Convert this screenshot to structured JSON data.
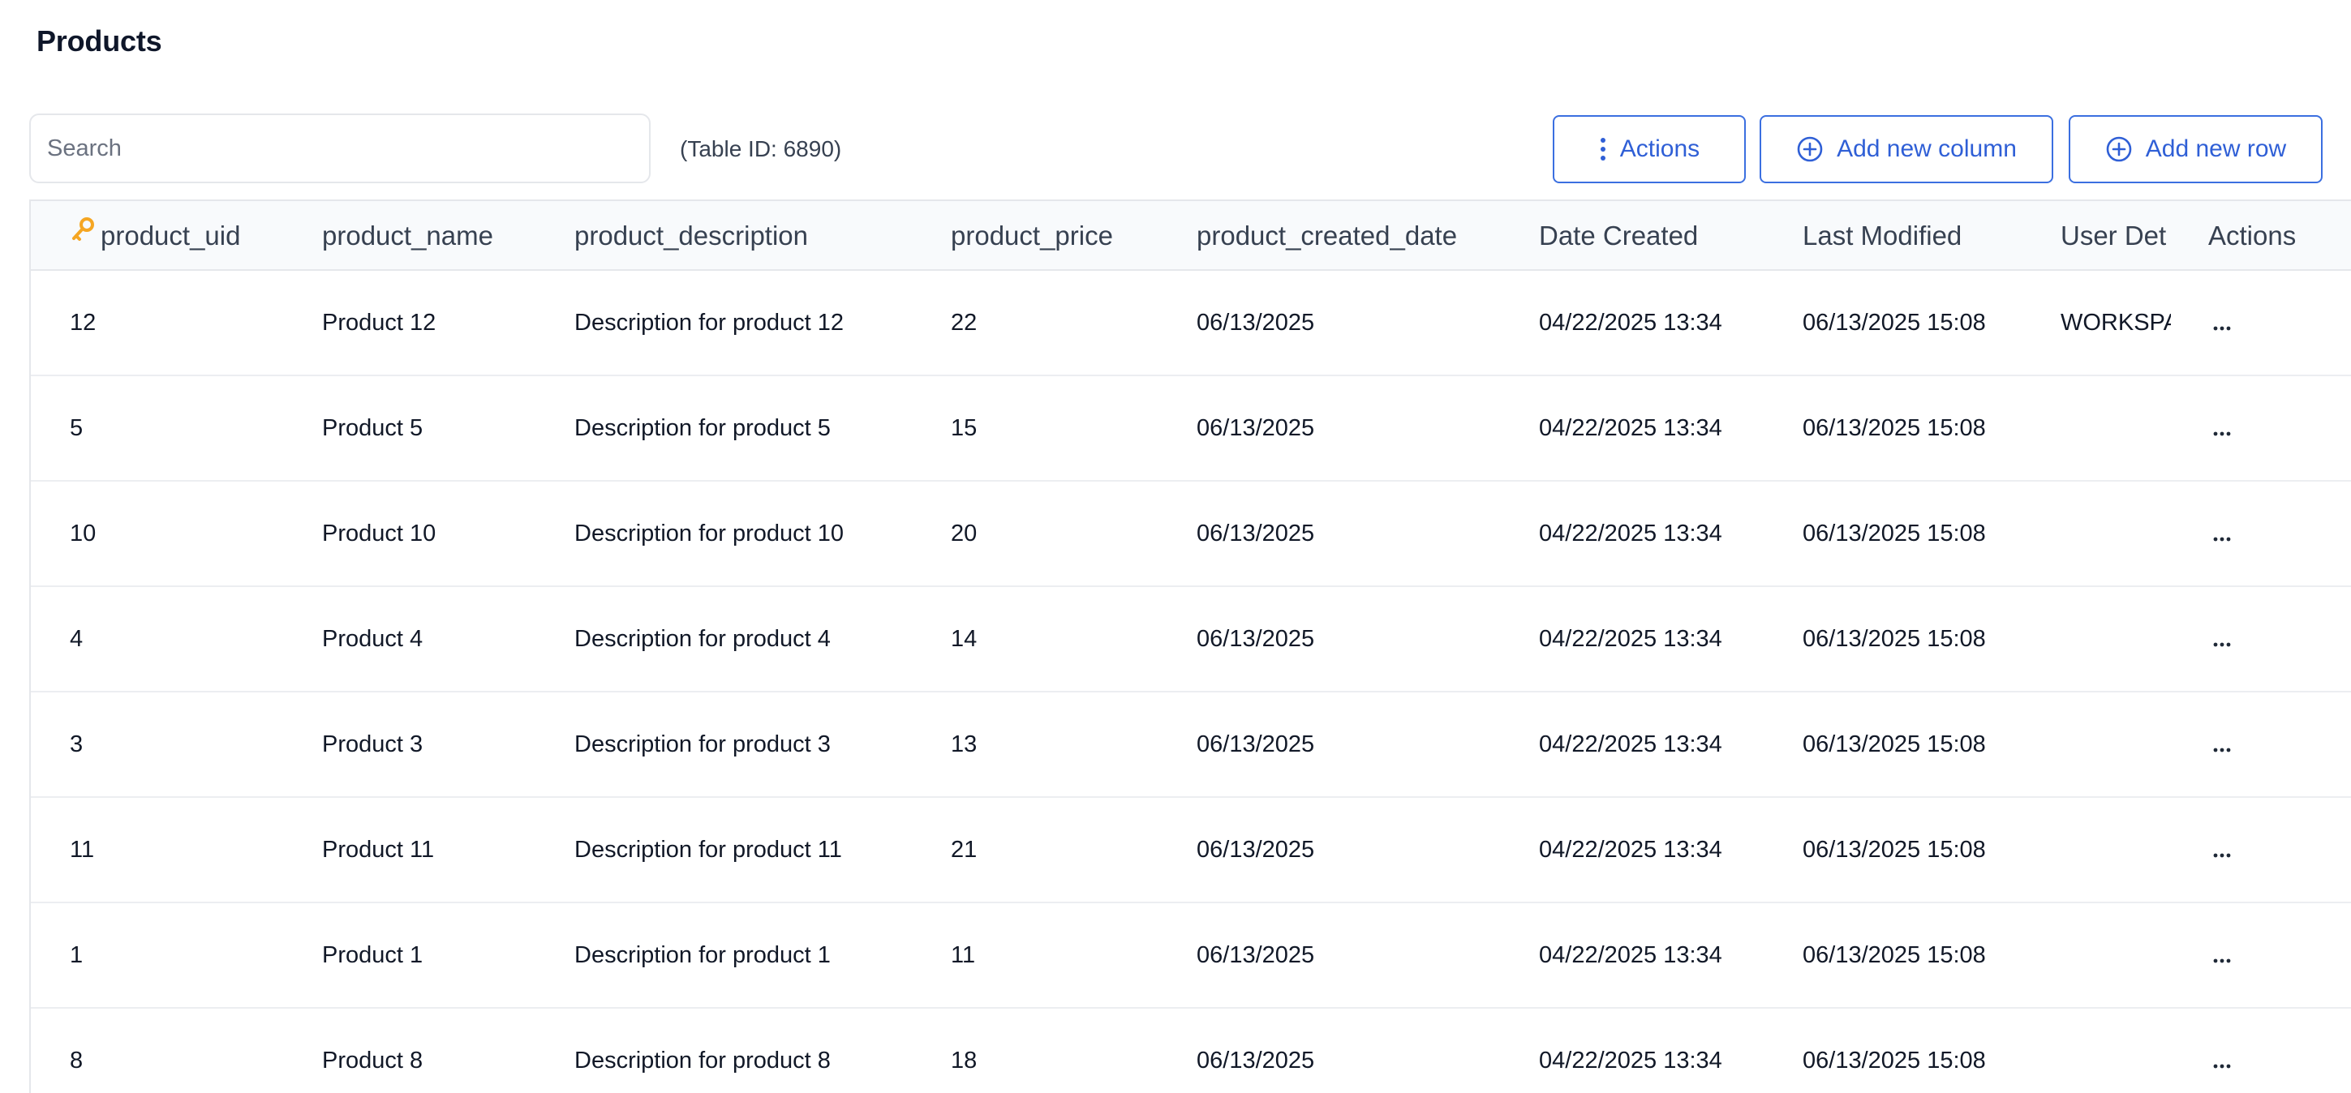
{
  "page": {
    "title": "Products"
  },
  "toolbar": {
    "search_placeholder": "Search",
    "table_id_label": "(Table ID: 6890)",
    "actions_label": "Actions",
    "add_column_label": "Add new column",
    "add_row_label": "Add new row"
  },
  "colors": {
    "accent": "#2f5fd6",
    "key_icon": "#f5a623",
    "header_bg": "#f8fafc",
    "border": "#e5e7eb"
  },
  "table": {
    "columns": [
      "product_uid",
      "product_name",
      "product_description",
      "product_price",
      "product_created_date",
      "Date Created",
      "Last Modified",
      "User Det",
      "Actions"
    ],
    "rows": [
      {
        "uid": "12",
        "name": "Product 12",
        "description": "Description for product 12",
        "price": "22",
        "created_date": "06/13/2025",
        "date_created": "04/22/2025 13:34",
        "last_modified": "06/13/2025 15:08",
        "user": "WORKSPA"
      },
      {
        "uid": "5",
        "name": "Product 5",
        "description": "Description for product 5",
        "price": "15",
        "created_date": "06/13/2025",
        "date_created": "04/22/2025 13:34",
        "last_modified": "06/13/2025 15:08",
        "user": ""
      },
      {
        "uid": "10",
        "name": "Product 10",
        "description": "Description for product 10",
        "price": "20",
        "created_date": "06/13/2025",
        "date_created": "04/22/2025 13:34",
        "last_modified": "06/13/2025 15:08",
        "user": ""
      },
      {
        "uid": "4",
        "name": "Product 4",
        "description": "Description for product 4",
        "price": "14",
        "created_date": "06/13/2025",
        "date_created": "04/22/2025 13:34",
        "last_modified": "06/13/2025 15:08",
        "user": ""
      },
      {
        "uid": "3",
        "name": "Product 3",
        "description": "Description for product 3",
        "price": "13",
        "created_date": "06/13/2025",
        "date_created": "04/22/2025 13:34",
        "last_modified": "06/13/2025 15:08",
        "user": ""
      },
      {
        "uid": "11",
        "name": "Product 11",
        "description": "Description for product 11",
        "price": "21",
        "created_date": "06/13/2025",
        "date_created": "04/22/2025 13:34",
        "last_modified": "06/13/2025 15:08",
        "user": ""
      },
      {
        "uid": "1",
        "name": "Product 1",
        "description": "Description for product 1",
        "price": "11",
        "created_date": "06/13/2025",
        "date_created": "04/22/2025 13:34",
        "last_modified": "06/13/2025 15:08",
        "user": ""
      },
      {
        "uid": "8",
        "name": "Product 8",
        "description": "Description for product 8",
        "price": "18",
        "created_date": "06/13/2025",
        "date_created": "04/22/2025 13:34",
        "last_modified": "06/13/2025 15:08",
        "user": ""
      }
    ]
  }
}
